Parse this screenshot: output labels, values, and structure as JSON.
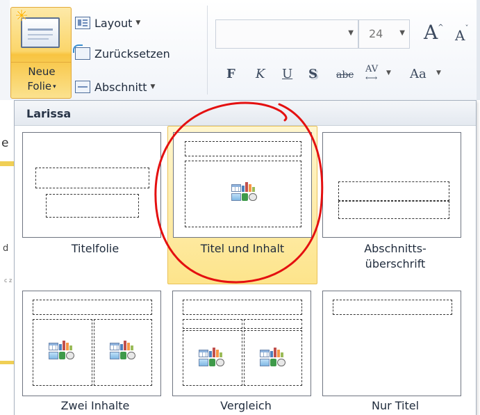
{
  "ribbon": {
    "new_slide": {
      "line1": "Neue",
      "line2": "Folie",
      "caret": "▾"
    },
    "layout_label": "Layout",
    "reset_label": "Zurücksetzen",
    "section_label": "Abschnitt",
    "font_name": "",
    "font_size": "24",
    "grow_font": "A",
    "shrink_font": "A",
    "format": {
      "bold": "F",
      "italic": "K",
      "underline": "U",
      "shadow": "S",
      "strike": "abc",
      "spacing": "AV",
      "spacing_arrow": "⟷",
      "change_case": "Aa"
    }
  },
  "background": {
    "partial_char": "e",
    "partial_mark": "d",
    "partial_small": "c z"
  },
  "gallery": {
    "title": "Larissa",
    "items": [
      {
        "label": "Titelfolie"
      },
      {
        "label": "Titel und Inhalt",
        "selected": true
      },
      {
        "label_line1": "Abschnitts-",
        "label_line2": "überschrift"
      },
      {
        "label": "Zwei Inhalte"
      },
      {
        "label": "Vergleich"
      },
      {
        "label": "Nur Titel"
      }
    ]
  },
  "annotation": {
    "color": "#e41010"
  },
  "colors": {
    "selected_fill": "#fde48b",
    "selected_border": "#e9c157",
    "ribbon_button": "#f8c441"
  }
}
